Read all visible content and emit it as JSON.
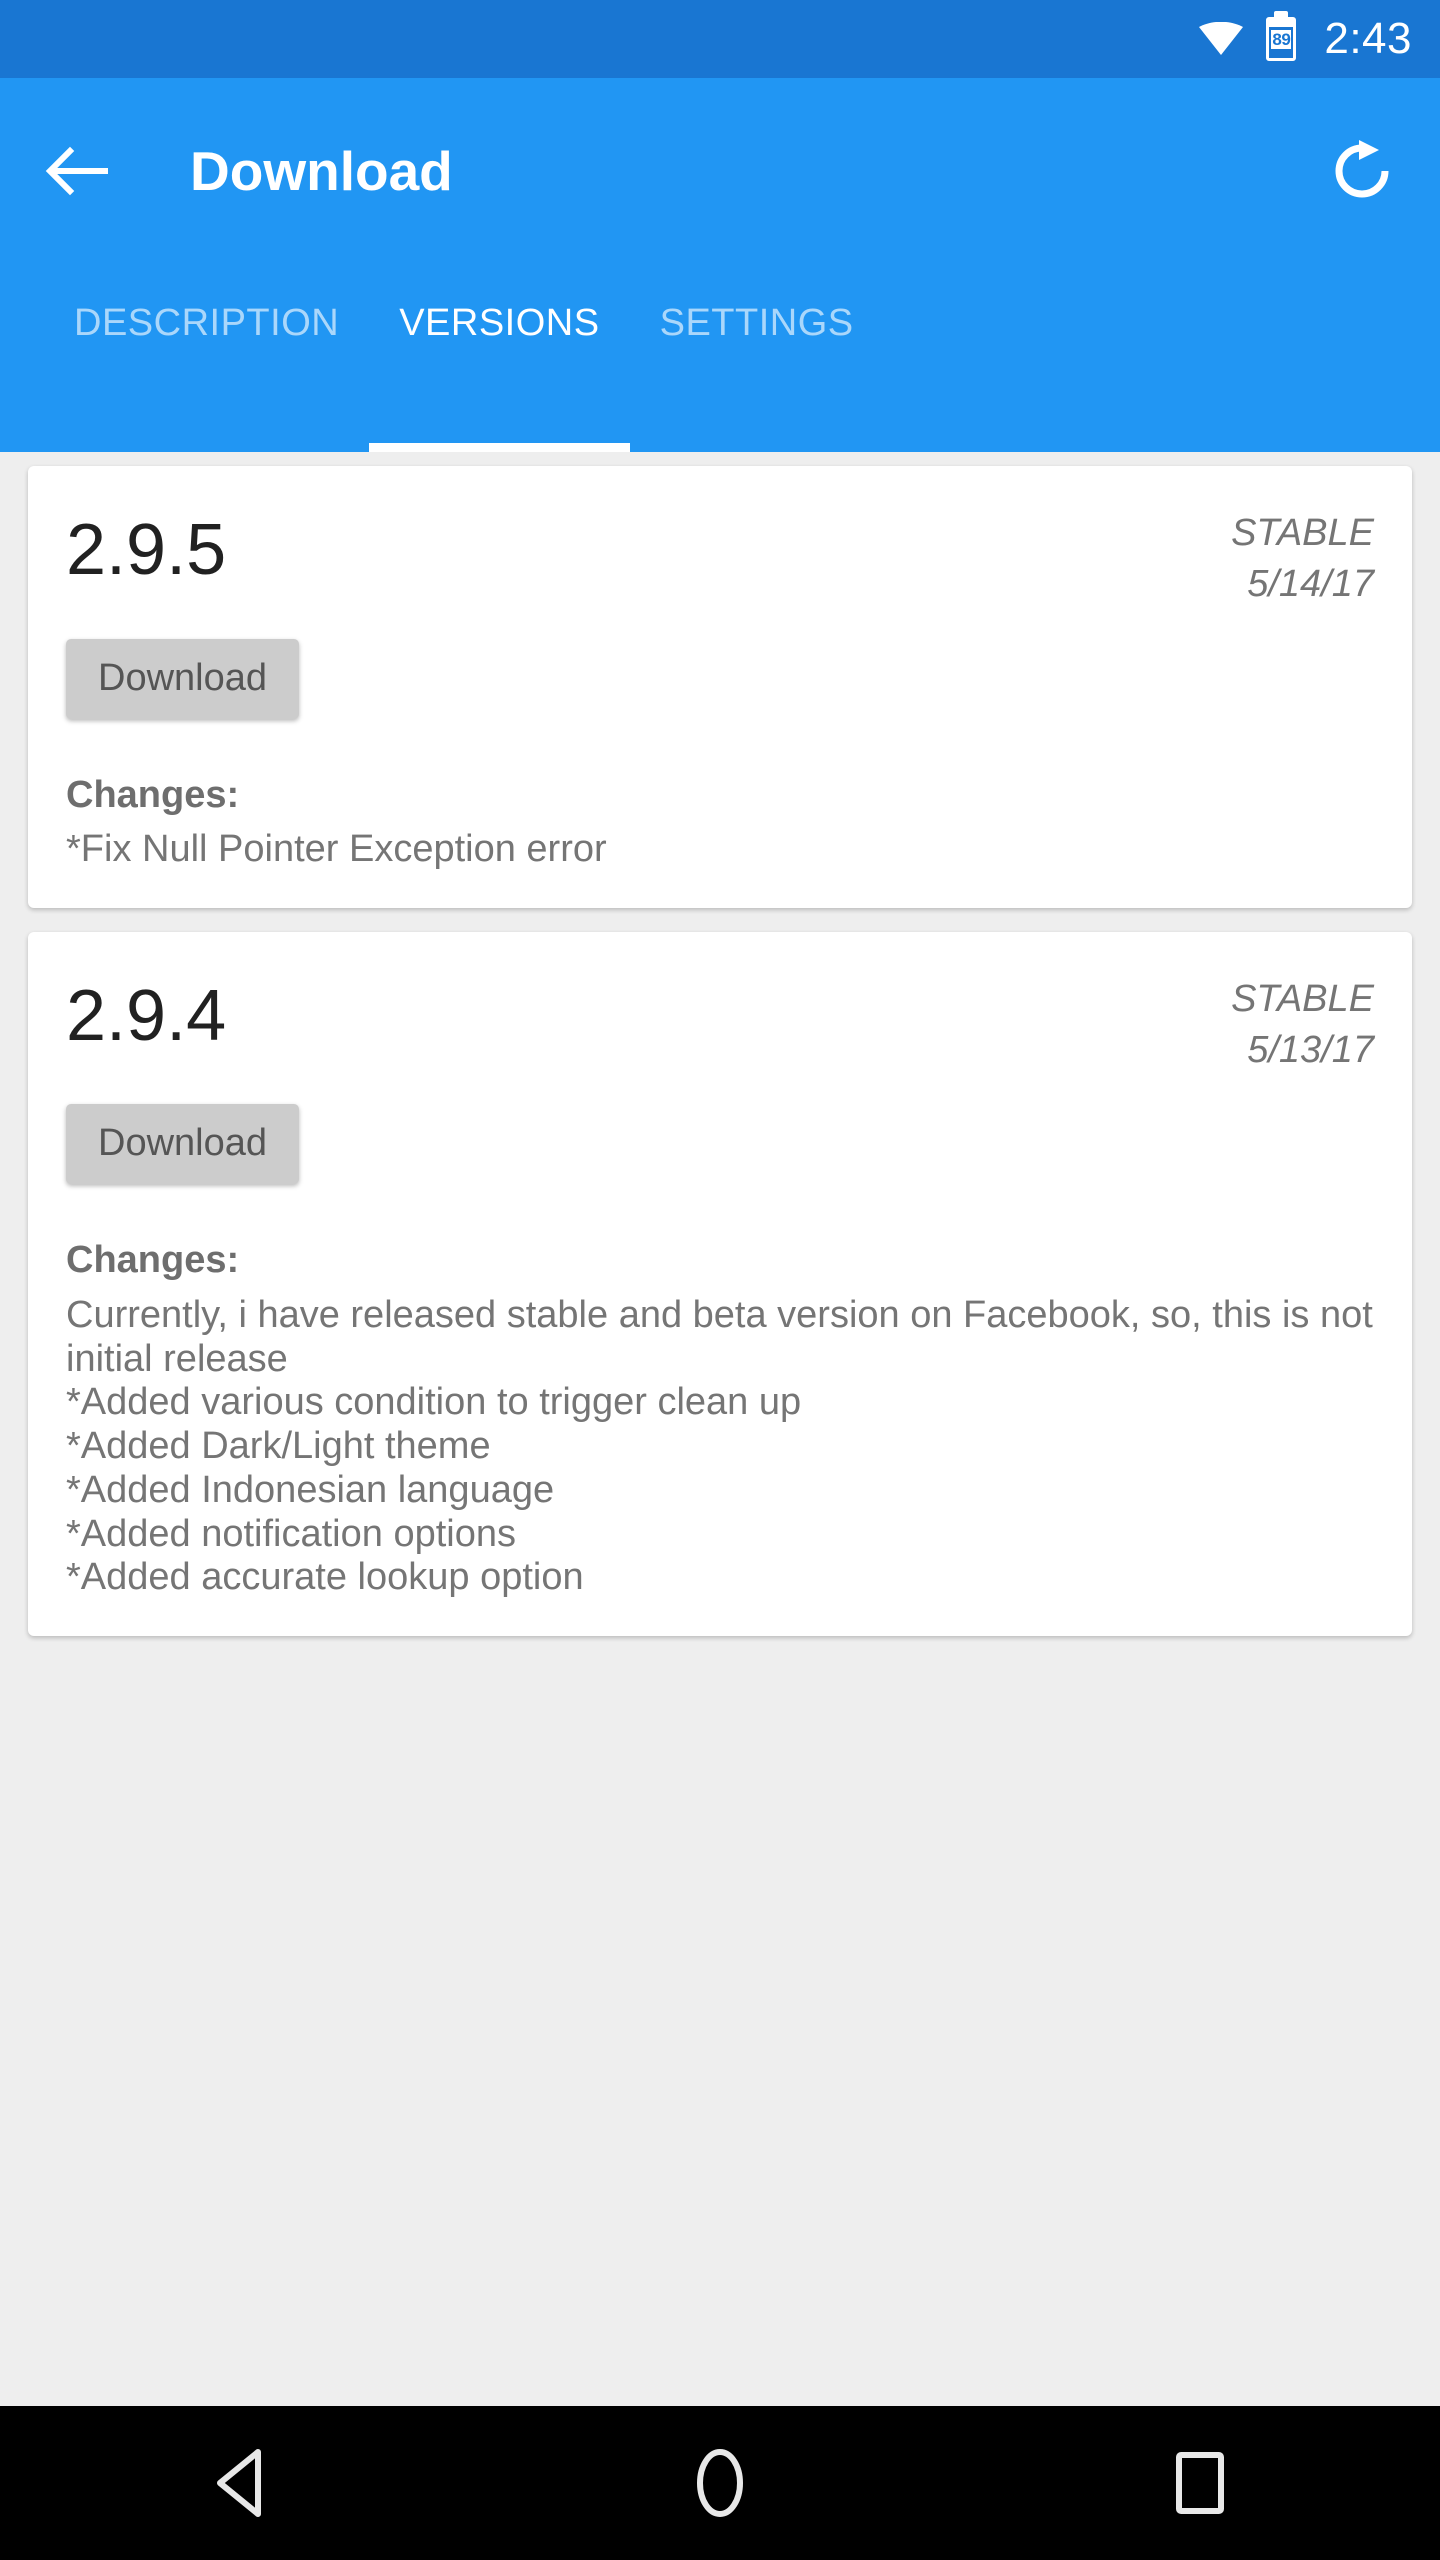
{
  "status_bar": {
    "wifi_icon": "wifi-icon",
    "battery_icon": "battery-icon",
    "battery_level": "89",
    "time": "2:43",
    "background_color": "#1976D2"
  },
  "app_bar": {
    "back_icon": "arrow-left-icon",
    "title": "Download",
    "refresh_icon": "refresh-icon",
    "background_color": "#2196F3"
  },
  "tabs": [
    {
      "label": "DESCRIPTION",
      "active": false
    },
    {
      "label": "VERSIONS",
      "active": true
    },
    {
      "label": "SETTINGS",
      "active": false
    }
  ],
  "versions": [
    {
      "number": "2.9.5",
      "channel": "STABLE",
      "date": "5/14/17",
      "download_label": "Download",
      "changes_label": "Changes:",
      "changes_body": "*Fix Null Pointer Exception error"
    },
    {
      "number": "2.9.4",
      "channel": "STABLE",
      "date": "5/13/17",
      "download_label": "Download",
      "changes_label": "Changes:",
      "changes_body": "Currently, i have released stable and beta version on Facebook, so, this is not initial release\n*Added various condition to trigger clean up\n*Added Dark/Light theme\n*Added Indonesian language\n*Added notification options\n*Added accurate lookup option"
    }
  ],
  "nav_bar": {
    "back_icon": "triangle-back-icon",
    "home_icon": "circle-home-icon",
    "recents_icon": "square-recents-icon",
    "background_color": "#000000"
  }
}
